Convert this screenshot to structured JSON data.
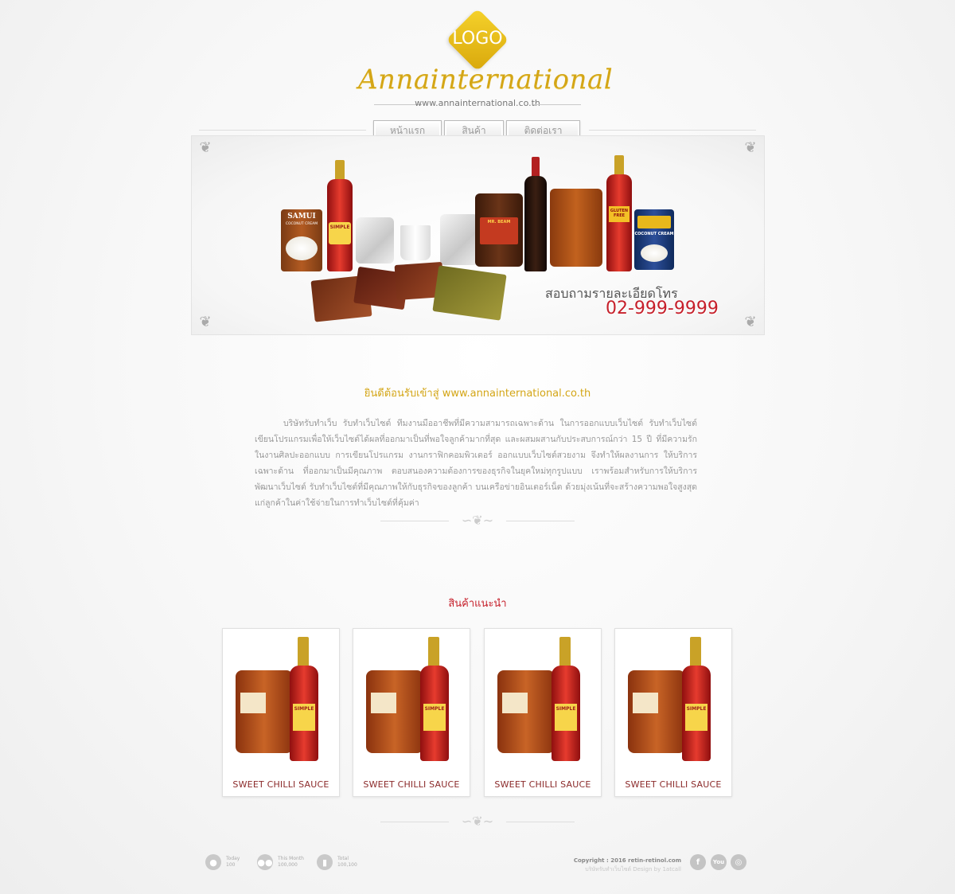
{
  "header": {
    "logo_text": "LOGO",
    "brand_name": "Annainternational",
    "url": "www.annainternational.co.th"
  },
  "nav": {
    "items": [
      {
        "label": "หน้าแรก"
      },
      {
        "label": "สินค้า"
      },
      {
        "label": "ติดต่อเรา"
      }
    ]
  },
  "banner": {
    "contact_label": "สอบถามรายละเอียดโทร",
    "phone": "02-999-9999",
    "product_labels": {
      "samui_can": "SAMUI",
      "samui_can_sub": "COCONUT CREAM",
      "simple_bottle": "SIMPLE",
      "oyster_bottle": "MR. BEAM",
      "gluten_bottle": "GLUTEN FREE",
      "coconut_can": "COCONUT CREAM"
    }
  },
  "welcome": {
    "title": "ยินดีต้อนรับเข้าสู่ www.annainternational.co.th",
    "body": "บริษัทรับทำเว็บ รับทำเว็บไซต์ ทีมงานมืออาชีพที่มีความสามารถเฉพาะด้าน ในการออกแบบเว็บไซต์ รับทำเว็บไซต์ เขียนโปรแกรมเพื่อให้เว็บไซต์ได้ผลที่ออกมาเป็นที่พอใจลูกค้ามากที่สุด และผสมผสานกับประสบการณ์กว่า 15 ปี ที่มีความรักในงานศิลปะออกแบบ การเขียนโปรแกรม งานกราฟิกคอมพิวเตอร์ ออกแบบเว็บไซต์สวยงาม จึงทำให้ผลงานการ ให้บริการเฉพาะด้าน ที่ออกมาเป็นมีคุณภาพ ตอบสนองความต้องการของธุรกิจในยุคใหม่ทุกรูปแบบ เราพร้อมสำหรับการให้บริการพัฒนาเว็บไซต์ รับทำเว็บไซต์ที่มีคุณภาพให้กับธุรกิจของลูกค้า บนเครือข่ายอินเตอร์เน็ต ด้วยมุ่งเน้นที่จะสร้างความพอใจสูงสุดแก่ลูกค้าในค่าใช้จ่ายในการทำเว็บไซต์ที่คุ้มค่า"
  },
  "recommended": {
    "title": "สินค้าแนะนำ",
    "products": [
      {
        "name": "SWEET CHILLI SAUCE",
        "bottle_label": "SIMPLE"
      },
      {
        "name": "SWEET CHILLI SAUCE",
        "bottle_label": "SIMPLE"
      },
      {
        "name": "SWEET CHILLI SAUCE",
        "bottle_label": "SIMPLE"
      },
      {
        "name": "SWEET CHILLI SAUCE",
        "bottle_label": "SIMPLE"
      }
    ]
  },
  "footer": {
    "stats": [
      {
        "icon": "user-icon",
        "label": "Today",
        "value": "100"
      },
      {
        "icon": "users-icon",
        "label": "This Month",
        "value": "100,000"
      },
      {
        "icon": "bar-chart-icon",
        "label": "Total",
        "value": "100,100"
      }
    ],
    "copyright": "Copyright : 2016 retin-retinol.com",
    "credit": "บริษัทรับทำเว็บไซต์ Design by 1atcall",
    "social": [
      {
        "icon": "facebook-icon",
        "glyph": "f"
      },
      {
        "icon": "youtube-icon",
        "glyph": "You"
      },
      {
        "icon": "instagram-icon",
        "glyph": "◎"
      }
    ]
  },
  "colors": {
    "gold": "#d4a617",
    "red": "#c6202b",
    "text_gray": "#999999"
  }
}
